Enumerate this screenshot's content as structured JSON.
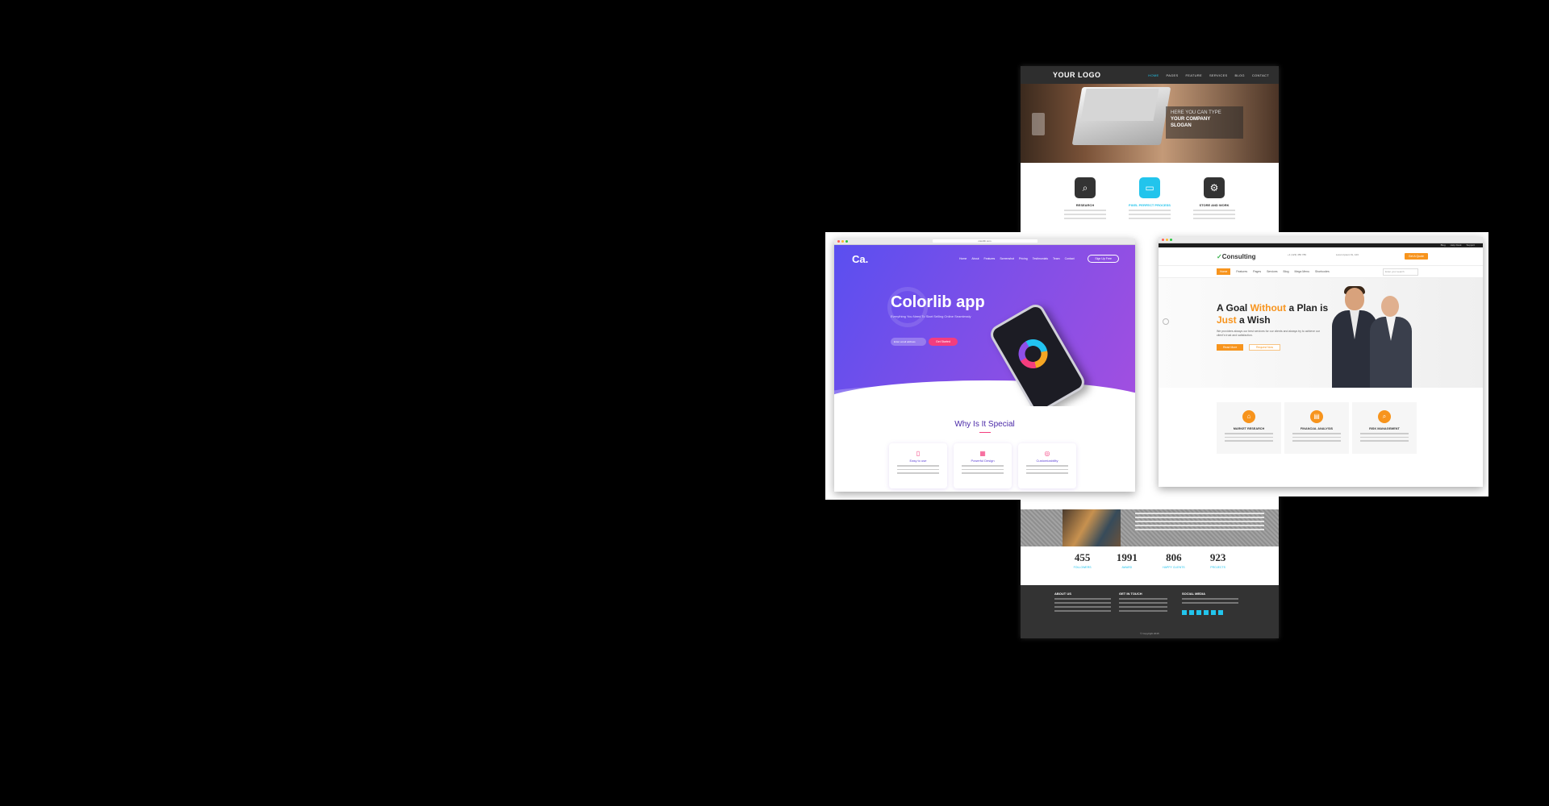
{
  "back_template": {
    "logo": "YOUR LOGO",
    "nav": [
      "HOME",
      "PAGES",
      "FEATURE",
      "SERVICES",
      "BLOG",
      "CONTACT"
    ],
    "hero": {
      "line1": "HERE YOU CAN TYPE",
      "line2": "YOUR COMPANY",
      "line3": "SLOGAN"
    },
    "features": [
      {
        "title": "RESEARCH",
        "icon": "magnifier-icon"
      },
      {
        "title": "PIXEL PERFECT PROCESS",
        "icon": "monitor-icon"
      },
      {
        "title": "STORE AND WORK",
        "icon": "gears-icon"
      }
    ],
    "stats": [
      {
        "value": "455",
        "label": "FOLLOWERS"
      },
      {
        "value": "1991",
        "label": "AWARD"
      },
      {
        "value": "806",
        "label": "HAPPY CLIENTS"
      },
      {
        "value": "923",
        "label": "PROJECTS"
      }
    ],
    "footer": {
      "about": "ABOUT US",
      "contact": "GET IN TOUCH",
      "social": "SOCIAL MEDIA",
      "copyright": "© Copyright 2015"
    }
  },
  "colorlib": {
    "url": "colorlib.com",
    "brand": "Ca.",
    "nav": [
      "Home",
      "About",
      "Features",
      "Screenshot",
      "Pricing",
      "Testimonials",
      "Team",
      "Contact"
    ],
    "signup": "Sign Up Free",
    "title": "Colorlib app",
    "subtitle": "Everything You Need To Start Selling Online Seamlessly",
    "email_placeholder": "Enter email address",
    "cta": "Get Started",
    "section_title": "Why Is It Special",
    "cards": [
      {
        "title": "Easy to use",
        "icon": "phone-icon"
      },
      {
        "title": "Powerful Design",
        "icon": "design-icon"
      },
      {
        "title": "Customizability",
        "icon": "target-icon"
      }
    ]
  },
  "consulting": {
    "topbar": [
      "Blog",
      "Help Desk",
      "Support"
    ],
    "logo_prefix": "",
    "logo": "Consulting",
    "phone": "+1 (123) 456 789",
    "address": "Lorem Ipsum St, 123",
    "quote": "Get A Quote",
    "menu": [
      "Home",
      "Features",
      "Pages",
      "Services",
      "Blog",
      "Mega Menu",
      "Shortcodes"
    ],
    "search_placeholder": "Enter your search",
    "hero_title_1": "A Goal ",
    "hero_title_2": "Without",
    "hero_title_3": " a Plan is",
    "hero_title_4": "Just",
    "hero_title_5": " a Wish",
    "hero_sub": "We providers always our best services for our clients and always try to achieve our client's trust and satisfaction.",
    "btn_primary": "Read More",
    "btn_secondary": "Request Now",
    "cards": [
      {
        "title": "MARKET RESEARCH",
        "icon": "house-icon"
      },
      {
        "title": "FINANCIAL ANALYSIS",
        "icon": "document-icon"
      },
      {
        "title": "RISK MANAGEMENT",
        "icon": "search-icon"
      }
    ]
  }
}
